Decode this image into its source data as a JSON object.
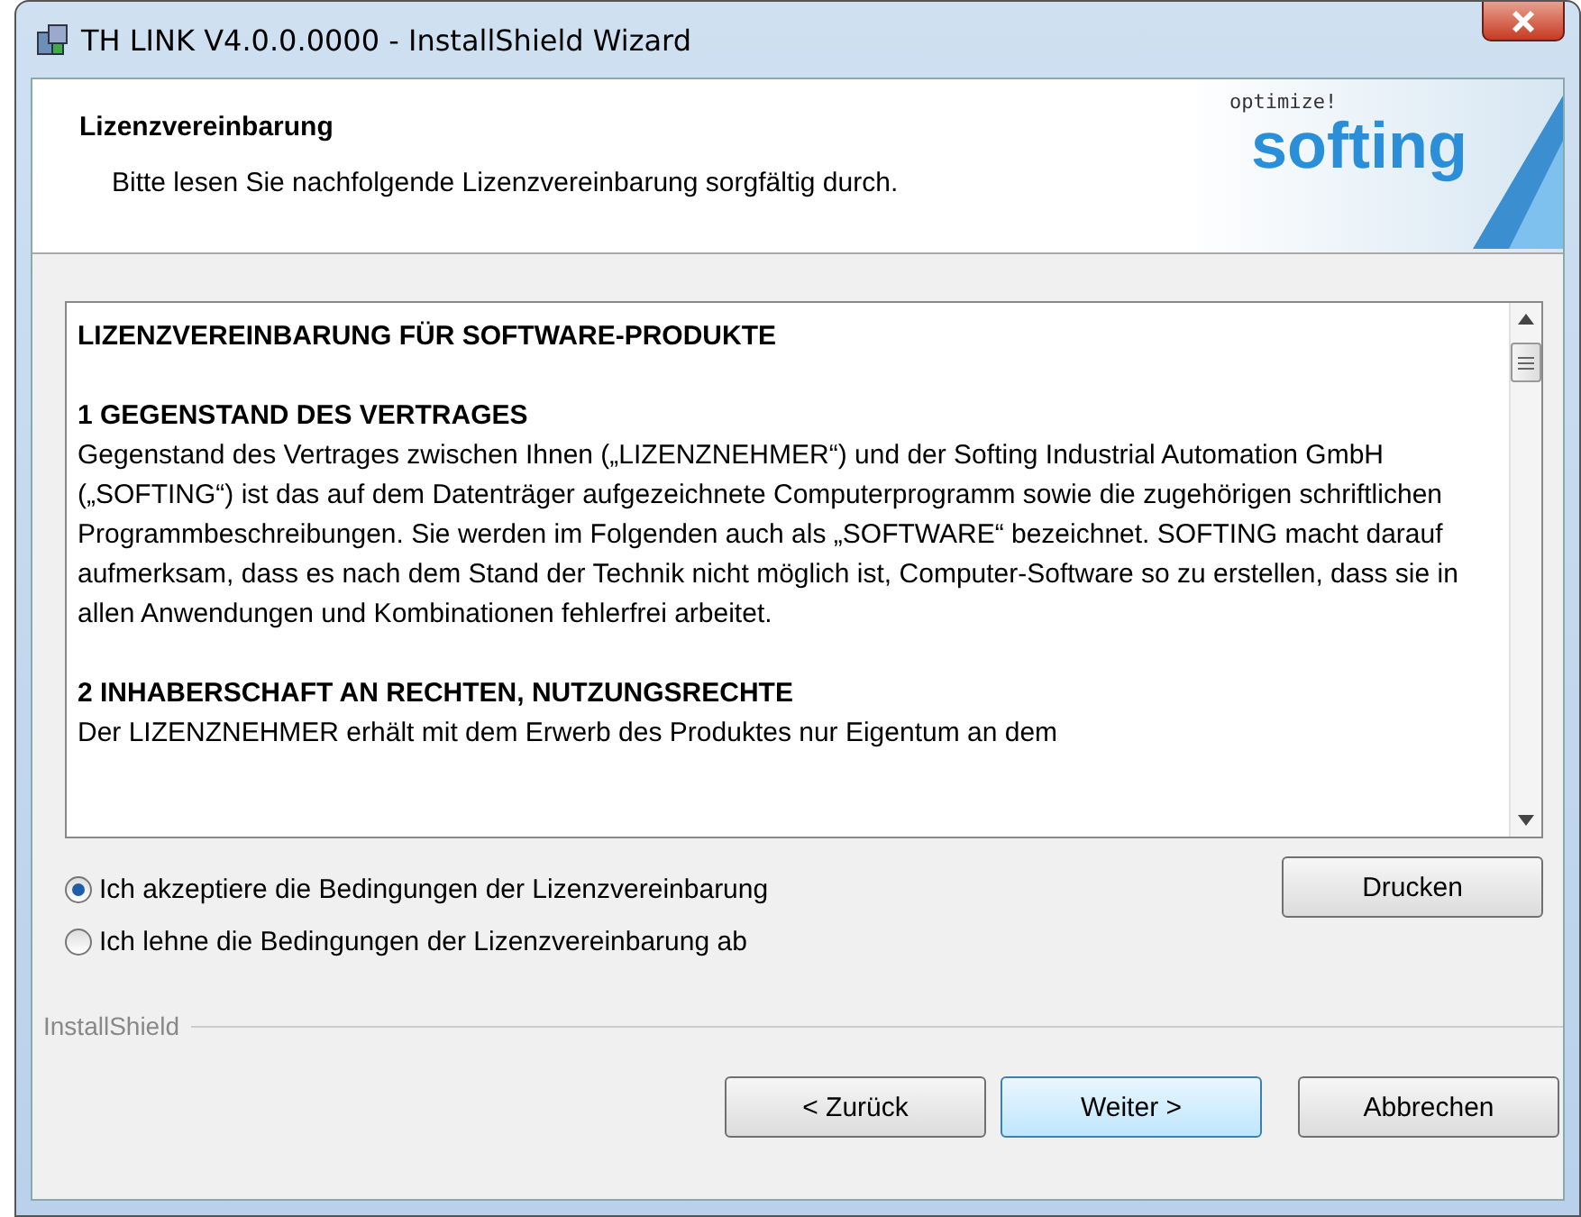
{
  "window": {
    "title": "TH LINK V4.0.0.0000 - InstallShield Wizard"
  },
  "header": {
    "title": "Lizenzvereinbarung",
    "subtitle": "Bitte lesen Sie nachfolgende Lizenzvereinbarung sorgfältig durch.",
    "logo_tagline": "optimize!",
    "logo_name": "softing"
  },
  "license": [
    {
      "kind": "heading",
      "text": "LIZENZVEREINBARUNG FÜR SOFTWARE-PRODUKTE"
    },
    {
      "kind": "heading",
      "text": "1 GEGENSTAND DES VERTRAGES"
    },
    {
      "kind": "paragraph",
      "text": "Gegenstand des Vertrages zwischen Ihnen („LIZENZNEHMER“) und der Softing Industrial Automation GmbH („SOFTING“) ist das auf dem Datenträger aufgezeichnete Computerprogramm sowie die zugehörigen schriftlichen Programmbeschreibungen. Sie werden im Folgenden auch als „SOFTWARE“ bezeichnet. SOFTING macht darauf aufmerksam, dass es nach dem Stand der Technik nicht möglich ist, Computer-Software so zu erstellen, dass sie in allen Anwendungen und Kombinationen fehlerfrei arbeitet."
    },
    {
      "kind": "heading",
      "text": "2 INHABERSCHAFT AN RECHTEN, NUTZUNGSRECHTE"
    },
    {
      "kind": "paragraph",
      "text": "Der LIZENZNEHMER erhält mit dem Erwerb des Produktes nur Eigentum an dem"
    }
  ],
  "options": [
    {
      "label": "Ich akzeptiere die Bedingungen der Lizenzvereinbarung",
      "selected": true
    },
    {
      "label": "Ich lehne die Bedingungen der Lizenzvereinbarung ab",
      "selected": false
    }
  ],
  "print_button": "Drucken",
  "footer_label": "InstallShield",
  "buttons": [
    {
      "label": "< Zurück",
      "default": false
    },
    {
      "label": "Weiter >",
      "default": true
    },
    {
      "label": "Abbrechen",
      "default": false
    }
  ]
}
